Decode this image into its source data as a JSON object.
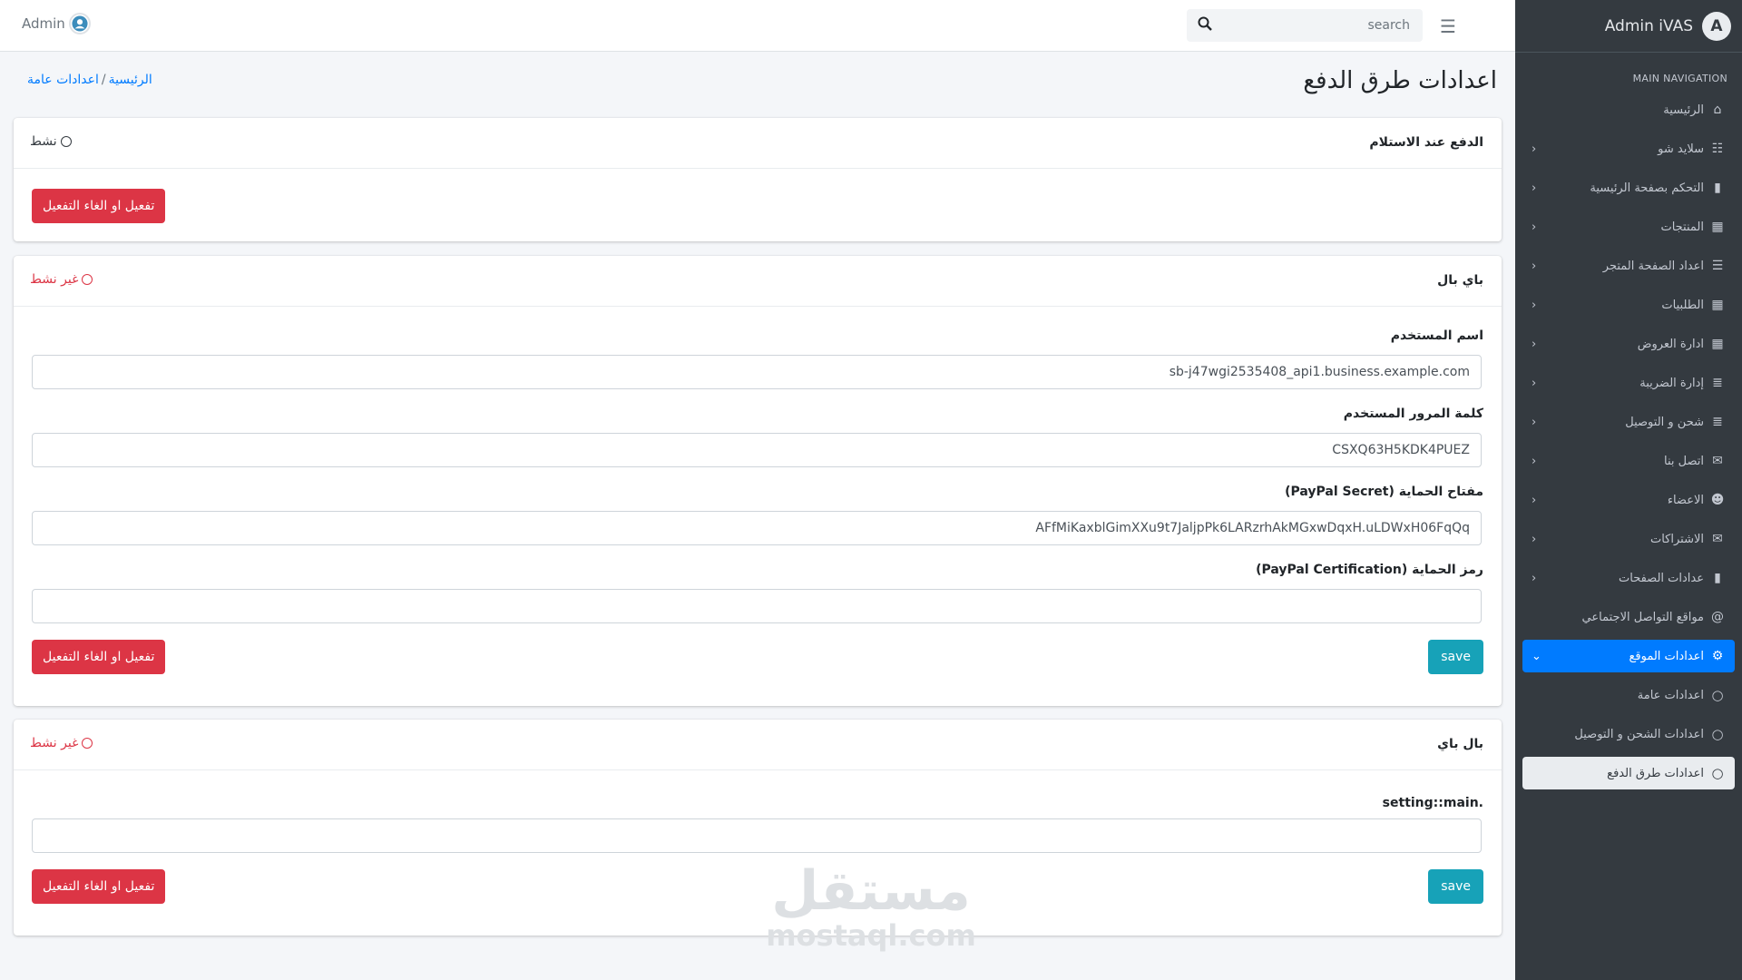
{
  "topbar": {
    "admin_label": "Admin",
    "search_placeholder": "search"
  },
  "sidebar": {
    "brand": "Admin iVAS",
    "brand_logo_letter": "A",
    "header": "MAIN NAVIGATION",
    "items": [
      {
        "label": "الرئيسية",
        "icon": "home-icon"
      },
      {
        "label": "سلايد شو",
        "icon": "sliders-icon"
      },
      {
        "label": "التحكم بصفحة الرئيسية",
        "icon": "file-icon"
      },
      {
        "label": "المنتجات",
        "icon": "boxes-icon"
      },
      {
        "label": "اعداد الصفحة المتجر",
        "icon": "list-icon"
      },
      {
        "label": "الطلبيات",
        "icon": "boxes-icon"
      },
      {
        "label": "ادارة العروض",
        "icon": "boxes-icon"
      },
      {
        "label": "إدارة الضريبة",
        "icon": "coins-icon"
      },
      {
        "label": "شحن و التوصيل",
        "icon": "coins-icon"
      },
      {
        "label": "اتصل بنا",
        "icon": "mailbox-icon"
      },
      {
        "label": "الاعضاء",
        "icon": "users-icon"
      },
      {
        "label": "الاشتراكات",
        "icon": "mailbox-icon"
      },
      {
        "label": "عدادات الصفحات",
        "icon": "file-icon"
      },
      {
        "label": "مواقع التواصل الاجتماعي",
        "icon": "at-icon"
      },
      {
        "label": "اعدادات الموقع",
        "icon": "cog-icon"
      },
      {
        "label": "اعدادات عامة",
        "icon": "circle-icon"
      },
      {
        "label": "اعدادات الشحن و التوصيل",
        "icon": "circle-icon"
      },
      {
        "label": "اعدادات طرق الدفع",
        "icon": "circle-icon"
      }
    ]
  },
  "page": {
    "title": "اعدادات طرق الدفع",
    "breadcrumb": {
      "home": "الرئيسية",
      "sep": "/",
      "current": "اعدادات عامة"
    }
  },
  "cards": {
    "cod": {
      "title": "الدفع عند الاستلام",
      "status": "نشط",
      "toggle_label": "تفعيل او الغاء التفعيل"
    },
    "paypal": {
      "title": "باي بال",
      "status": "غير نشط",
      "username_label": "اسم المستخدم",
      "username_value": "sb-j47wgi2535408_api1.business.example.com",
      "password_label": "كلمة المرور المستخدم",
      "password_value": "CSXQ63H5KDK4PUEZ",
      "secret_label": "مفتاح الحماية (PayPal Secret)",
      "secret_value": "AFfMiKaxblGimXXu9t7JaljpPk6LARzrhAkMGxwDqxH.uLDWxH06FqQq",
      "cert_label": "رمز الحماية (PayPal Certification)",
      "cert_value": "",
      "save_label": "save",
      "toggle_label": "تفعيل او الغاء التفعيل"
    },
    "paypay": {
      "title": "بال باي",
      "status": "غير نشط",
      "field_label": ".setting::main",
      "field_value": "",
      "save_label": "save",
      "toggle_label": "تفعيل او الغاء التفعيل"
    }
  },
  "watermark": {
    "arabic": "مستقل",
    "latin": "mostaql.com"
  }
}
